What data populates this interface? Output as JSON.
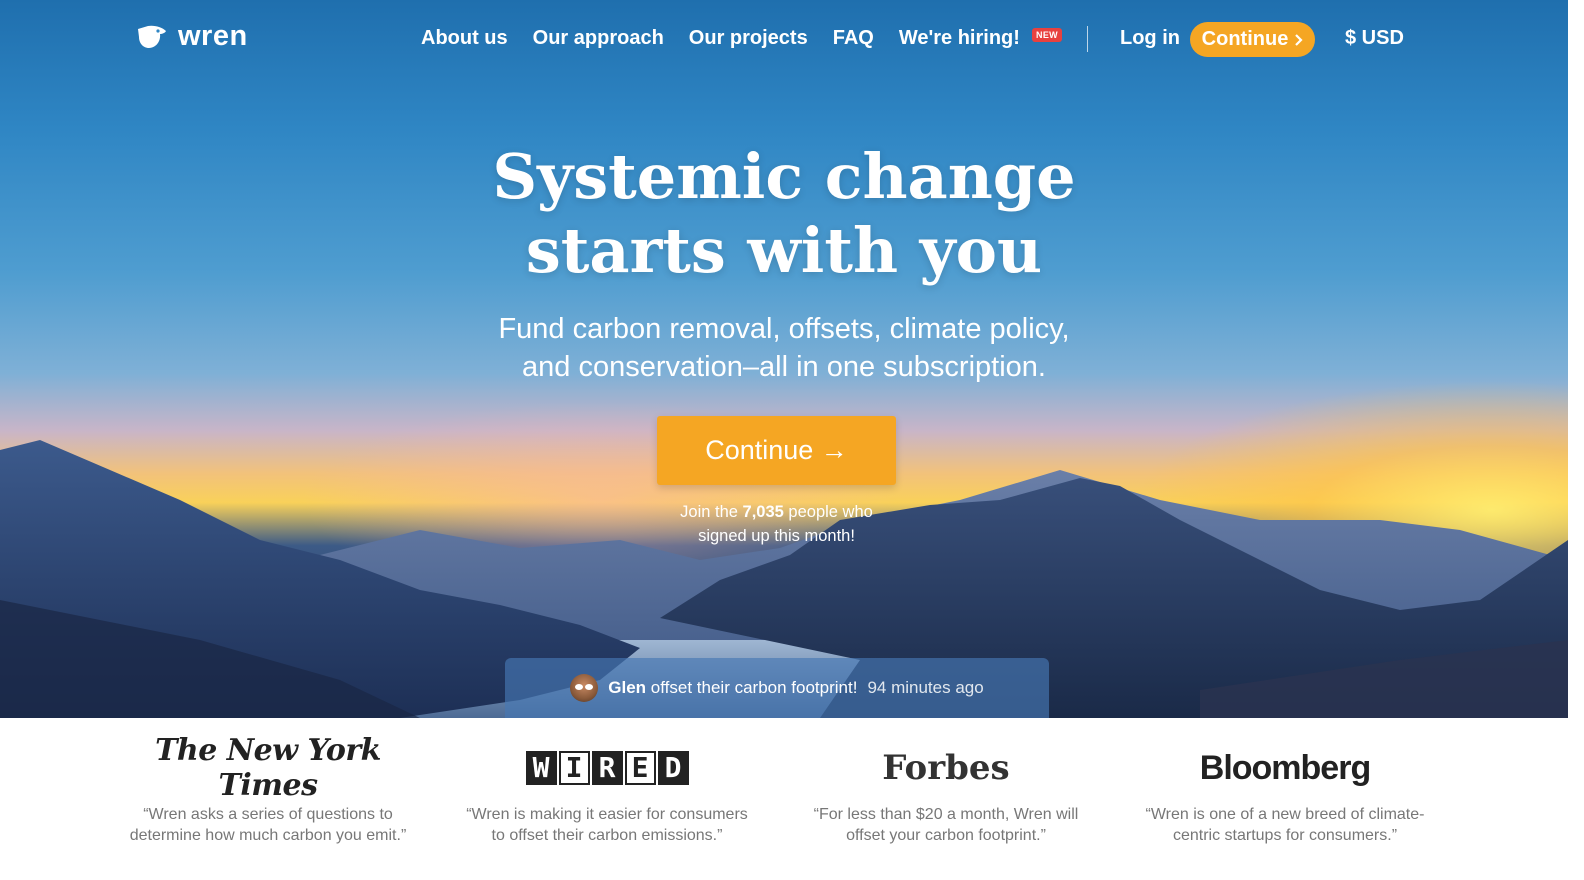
{
  "brand": {
    "name": "wren"
  },
  "nav": {
    "links": [
      "About us",
      "Our approach",
      "Our projects",
      "FAQ"
    ],
    "hiring": {
      "label": "We're hiring!",
      "badge": "NEW"
    },
    "login": "Log in",
    "continue": "Continue",
    "currency": "$ USD"
  },
  "hero": {
    "headline_line1": "Systemic change",
    "headline_line2": "starts with you",
    "sub_line1": "Fund carbon removal, offsets, climate policy,",
    "sub_line2": "and conservation–all in one subscription.",
    "cta": "Continue →",
    "joined_prefix": "Join the ",
    "joined_count": "7,035",
    "joined_suffix": " people who",
    "joined_line2": "signed up this month!"
  },
  "ticker": {
    "name": "Glen",
    "action": " offset their carbon footprint!",
    "time": "94 minutes ago"
  },
  "press": [
    {
      "outlet": "The New York Times",
      "quote_line1": "“Wren asks a series of questions to",
      "quote_line2": "determine how much carbon you emit.”"
    },
    {
      "outlet": "WIRED",
      "quote_line1": "“Wren is making it easier for consumers",
      "quote_line2": "to offset their carbon emissions.”"
    },
    {
      "outlet": "Forbes",
      "quote_line1": "“For less than $20 a month, Wren will",
      "quote_line2": "offset your carbon footprint.”"
    },
    {
      "outlet": "Bloomberg",
      "quote_line1": "“Wren is one of a new breed of climate-",
      "quote_line2": "centric startups for consumers.”"
    }
  ],
  "colors": {
    "accent": "#f5a623",
    "badge": "#e8413f"
  }
}
